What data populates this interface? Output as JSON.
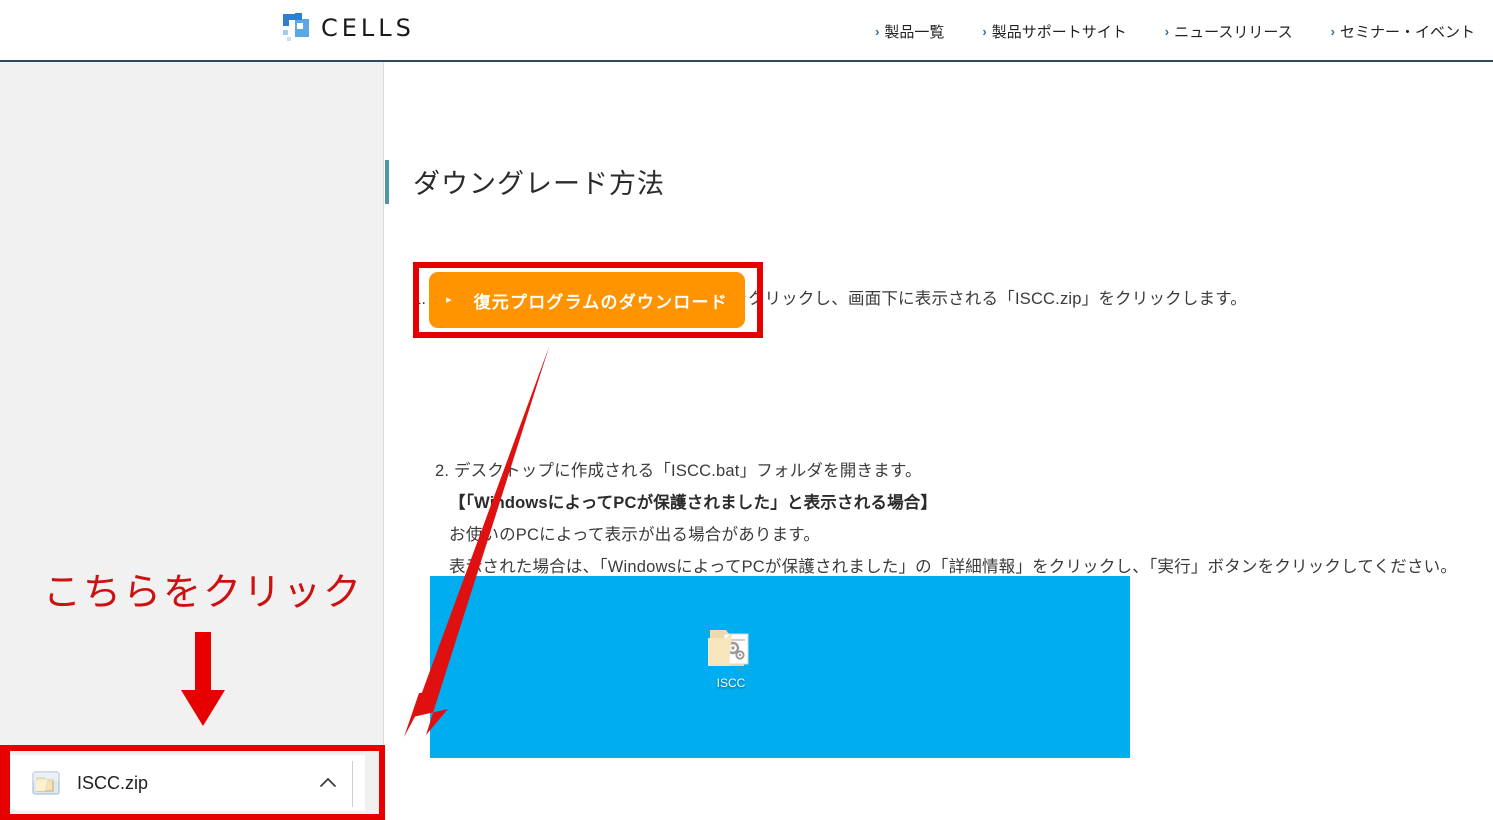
{
  "header": {
    "logo_text": "CELLS",
    "logo_icon": "cells-logo-icon",
    "nav": [
      {
        "label": "製品一覧",
        "chevron": "›"
      },
      {
        "label": "製品サポートサイト",
        "chevron": "›"
      },
      {
        "label": "ニュースリリース",
        "chevron": "›"
      },
      {
        "label": "セミナー・イベント",
        "chevron": "›"
      }
    ]
  },
  "main": {
    "page_title": "ダウングレード方法",
    "steps": {
      "step1": "1. 下記「復元プログラムのダウンロード」をクリックし、画面下に表示される「ISCC.zip」をクリックします。",
      "step2": "2. デスクトップに作成される「ISCC.bat」フォルダを開きます。",
      "step2b": "【「WindowsによってPCが保護されました」と表示される場合】",
      "step2c": "お使いのPCによって表示が出る場合があります。",
      "step2d": "表示された場合は、「WindowsによってPCが保護されました」の「詳細情報」をクリックし、「実行」ボタンをクリックしてください。"
    },
    "download_button": {
      "label": "復元プログラムのダウンロード",
      "marker": "▸"
    },
    "desktop_screenshot": {
      "icon_label": "ISCC",
      "icon_name": "folder-gears-icon"
    }
  },
  "annotations": {
    "callout_text": "こちらをクリック",
    "arrow_down_icon": "arrow-down-icon",
    "arrow_diagonal_icon": "arrow-diagonal-icon",
    "highlight_color": "#e60000"
  },
  "download_bar": {
    "file_name": "ISCC.zip",
    "file_icon": "zip-folder-icon",
    "chevron_icon": "chevron-up-icon"
  },
  "colors": {
    "orange_button": "#ff9300",
    "annotation_red": "#e60000",
    "callout_red": "#cc1111",
    "title_accent": "#4e93b0",
    "desktop_blue": "#00adef",
    "nav_chevron_blue": "#2d6ea8",
    "header_border": "#2e4a63",
    "sidebar_bg": "#f1f1f1"
  }
}
